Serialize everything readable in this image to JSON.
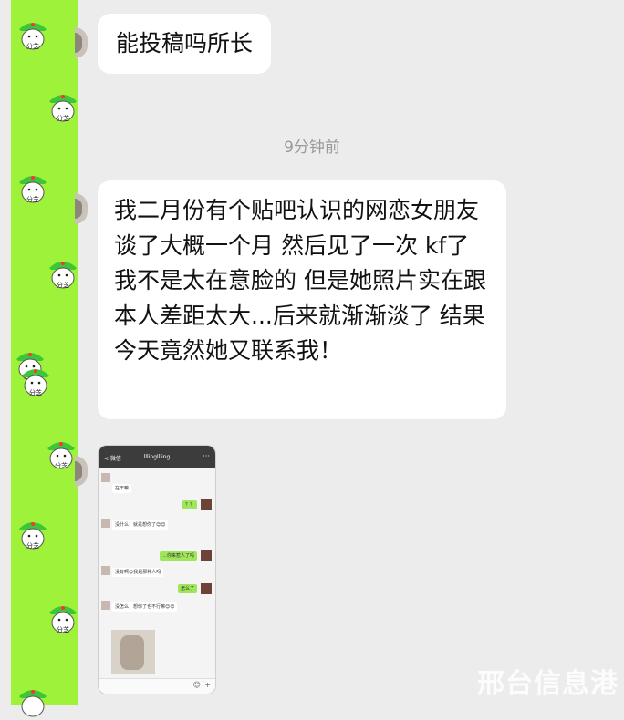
{
  "chat": {
    "message1": "能投稿吗所长",
    "timestamp": "9分钟前",
    "message2": "我二月份有个贴吧认识的网恋女朋友 谈了大概一个月 然后见了一次 kf了 我不是太在意脸的 但是她照片实在跟本人差距太大...后来就渐渐淡了 结果今天竟然她又联系我！"
  },
  "sticker": {
    "text": "分芝"
  },
  "screenshot": {
    "back": "< 微信",
    "title": "lllingllling",
    "more": "···",
    "messages": [
      {
        "side": "left",
        "text": "在干嘛"
      },
      {
        "side": "right",
        "text": "？？"
      },
      {
        "side": "left",
        "text": "没什么，就是想你了😊😊"
      },
      {
        "side": "right",
        "text": "...你来惹人了吗"
      },
      {
        "side": "left",
        "text": "没有啊😊我是那种人吗"
      },
      {
        "side": "right",
        "text": "怎么了"
      },
      {
        "side": "left",
        "text": "没怎么，想你了也不行嘛😊😊"
      }
    ],
    "bottom_icons": [
      "😊",
      "+"
    ]
  },
  "watermark": "邢台信息港",
  "colors": {
    "sticker_green": "#9ef23a",
    "wechat_bubble_green": "#9fe65a",
    "background": "#ececec"
  }
}
